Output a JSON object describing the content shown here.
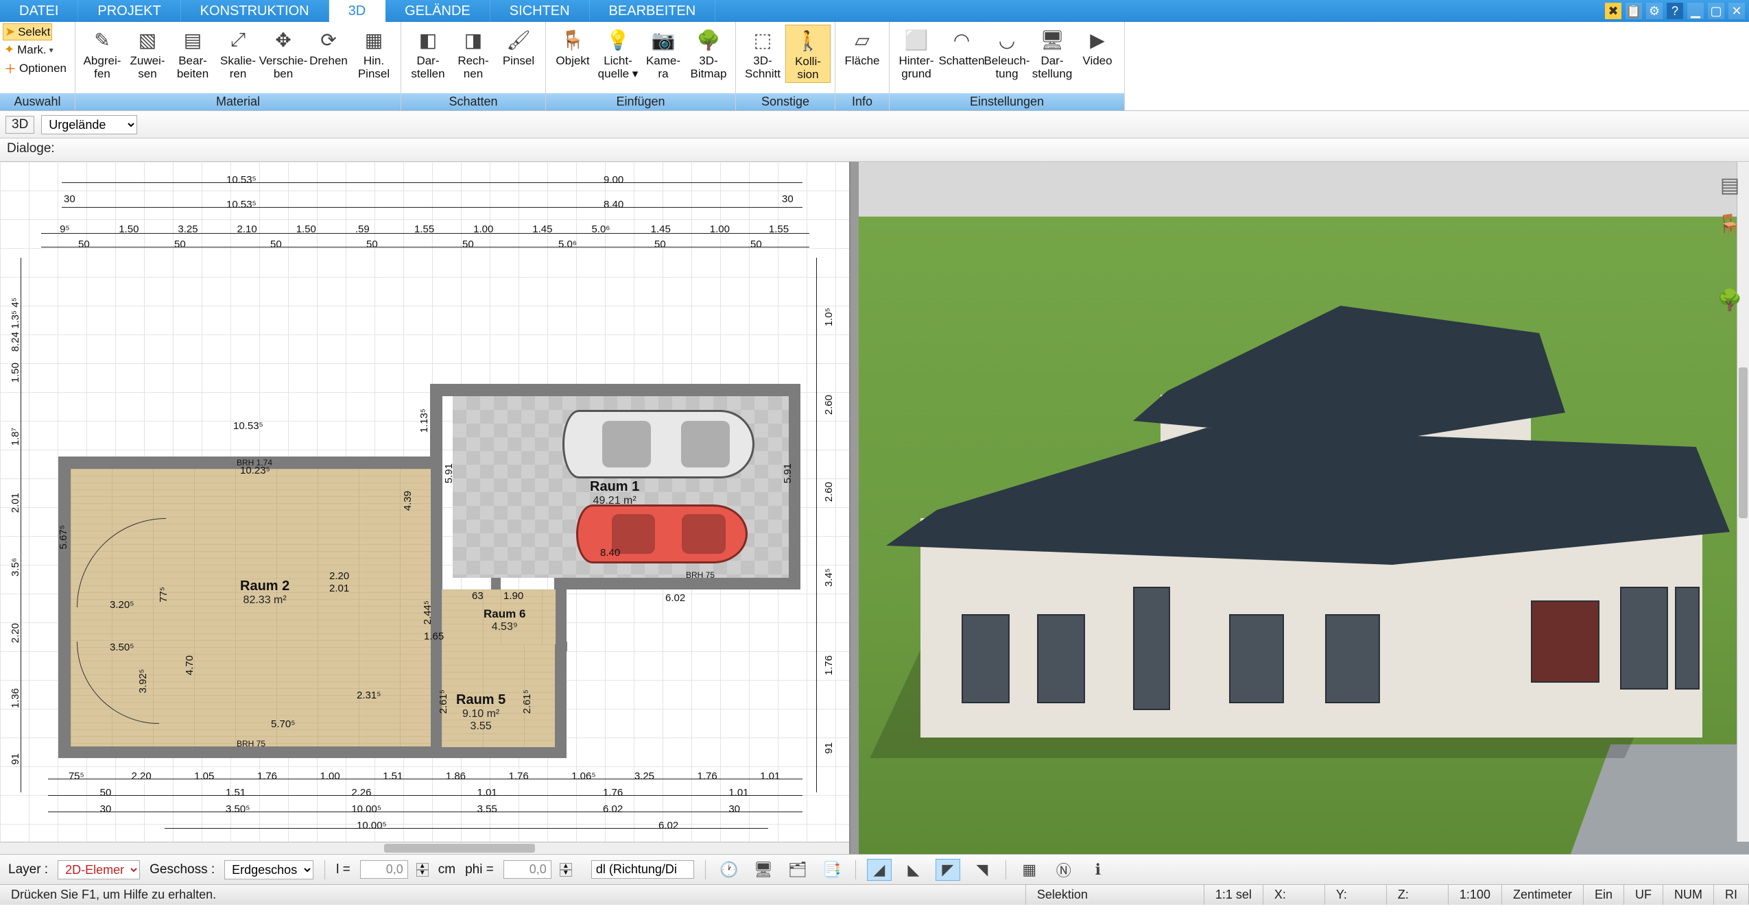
{
  "menu": {
    "tabs": [
      "DATEI",
      "PROJEKT",
      "KONSTRUKTION",
      "3D",
      "GELÄNDE",
      "SICHTEN",
      "BEARBEITEN"
    ],
    "active": 3
  },
  "auswahl": {
    "selekt": "Selekt",
    "mark": "Mark.",
    "optionen": "Optionen",
    "group": "Auswahl"
  },
  "ribbon_groups": [
    {
      "label": "Material",
      "buttons": [
        {
          "id": "abgreifen",
          "l1": "Abgrei-",
          "l2": "fen",
          "icon": "✎"
        },
        {
          "id": "zuweisen",
          "l1": "Zuwei-",
          "l2": "sen",
          "icon": "▧"
        },
        {
          "id": "bearbeiten",
          "l1": "Bear-",
          "l2": "beiten",
          "icon": "▤"
        },
        {
          "id": "skalieren",
          "l1": "Skalie-",
          "l2": "ren",
          "icon": "⤢"
        },
        {
          "id": "verschieben",
          "l1": "Verschie-",
          "l2": "ben",
          "icon": "✥"
        },
        {
          "id": "drehen",
          "l1": "Drehen",
          "l2": "",
          "icon": "⟳"
        },
        {
          "id": "hinpinsel",
          "l1": "Hin.",
          "l2": "Pinsel",
          "icon": "▦"
        }
      ]
    },
    {
      "label": "Schatten",
      "buttons": [
        {
          "id": "darstellen",
          "l1": "Dar-",
          "l2": "stellen",
          "icon": "◧"
        },
        {
          "id": "rechnen",
          "l1": "Rech-",
          "l2": "nen",
          "icon": "◨"
        },
        {
          "id": "pinsel",
          "l1": "Pinsel",
          "l2": "",
          "icon": "🖌"
        }
      ]
    },
    {
      "label": "Einfügen",
      "buttons": [
        {
          "id": "objekt",
          "l1": "Objekt",
          "l2": "",
          "icon": "🪑"
        },
        {
          "id": "lichtquelle",
          "l1": "Licht-",
          "l2": "quelle ▾",
          "icon": "💡"
        },
        {
          "id": "kamera",
          "l1": "Kame-",
          "l2": "ra",
          "icon": "📷"
        },
        {
          "id": "bitmap3d",
          "l1": "3D-",
          "l2": "Bitmap",
          "icon": "🌳"
        }
      ]
    },
    {
      "label": "Sonstige",
      "buttons": [
        {
          "id": "schnitt3d",
          "l1": "3D-",
          "l2": "Schnitt",
          "icon": "⬚"
        },
        {
          "id": "kollision",
          "l1": "Kolli-",
          "l2": "sion",
          "icon": "🚶",
          "active": true
        }
      ]
    },
    {
      "label": "Info",
      "buttons": [
        {
          "id": "flaeche",
          "l1": "Fläche",
          "l2": "",
          "icon": "▱"
        }
      ]
    },
    {
      "label": "Einstellungen",
      "buttons": [
        {
          "id": "hintergrund",
          "l1": "Hinter-",
          "l2": "grund",
          "icon": "⬜"
        },
        {
          "id": "schatten2",
          "l1": "Schatten",
          "l2": "",
          "icon": "◠"
        },
        {
          "id": "beleuchtung",
          "l1": "Beleuch-",
          "l2": "tung",
          "icon": "◡"
        },
        {
          "id": "darstellung",
          "l1": "Dar-",
          "l2": "stellung",
          "icon": "🖥"
        },
        {
          "id": "video",
          "l1": "Video",
          "l2": "",
          "icon": "▶"
        }
      ]
    }
  ],
  "secbar": {
    "badge": "3D",
    "dropdown": "Urgelände"
  },
  "dialogbar": {
    "label": "Dialoge:"
  },
  "plan": {
    "dims_top1": {
      "a": "10.53⁵",
      "b": "9.00"
    },
    "dims_top2": {
      "a": "10.53⁵",
      "b": "8.40"
    },
    "dims_top3": [
      "9⁵",
      "1.50",
      "3.25",
      "2.10",
      "1.50",
      ".59",
      "1.55",
      "1.00",
      "1.45",
      "5.0⁶",
      "1.45",
      "1.00",
      "1.55"
    ],
    "dims_top4": [
      "50",
      "50",
      "50",
      "50",
      "50",
      "5.0⁶",
      "50",
      "50"
    ],
    "dims_side_left": [
      "91",
      "1.36",
      "2.20",
      "3.5⁶",
      "2.01",
      "1.8⁷",
      "1.50",
      "8.24 1.3⁵ 4⁵"
    ],
    "dims_side_right": [
      "91",
      "1.76",
      "3.4⁵",
      "2.60",
      "2.60",
      "1.0⁵"
    ],
    "dims_bot1": [
      "75⁵",
      "2.20",
      "1.05",
      "1.76",
      "1.00",
      "1.51",
      "1.86",
      "1.76",
      "1.06⁵",
      "3.25",
      "1.76",
      "1.01"
    ],
    "dims_bot2": [
      "50",
      "1.51",
      "2.26",
      "1.01",
      "1.76",
      "1.01"
    ],
    "dims_bot3": [
      "30",
      "3.50⁵",
      "10.00⁵",
      "3.55",
      "6.02",
      "30"
    ],
    "dims_bot4": [
      "10.00⁵",
      "6.02"
    ],
    "dim_overall_bot": "10.00⁵",
    "i_left_a": "10.53⁵",
    "i_left_b": "10.23⁵",
    "i_6_02": "6.02",
    "i_190": "1.90",
    "i_570": "5.70⁵",
    "i_470": "4.70",
    "i_392": "3.92⁵",
    "i_320": "3.20⁵",
    "i_350": "3.50⁵",
    "i_439": "4.39",
    "i_591a": "5.91",
    "i_591b": "5.91",
    "i_840": "8.40",
    "i_455": "4.53⁹",
    "i_190b": "1.90",
    "i_244": "2.44⁵",
    "i_165": "1.65",
    "i_63": "63",
    "i_261a": "2.61⁵",
    "i_261b": "2.61⁵",
    "i_220": "2.20",
    "i_201": "2.01",
    "i_567": "5.67⁵",
    "i_77": "77⁵",
    "i_113": "1.13⁵",
    "i_231": "2.31⁵",
    "brh": "BRH 1.74",
    "brh75": "BRH 75",
    "room1": {
      "name": "Raum 1",
      "area": "49.21 m²"
    },
    "room2": {
      "name": "Raum 2",
      "area": "82.33 m²"
    },
    "room5": {
      "name": "Raum 5",
      "area": "9.10 m²",
      "w": "3.55"
    },
    "room6": {
      "name": "Raum 6",
      "area": "4.53⁹"
    },
    "marker30": "30"
  },
  "toolbar2": {
    "layer_lbl": "Layer :",
    "layer_val": "2D-Elemen",
    "geschoss_lbl": "Geschoss :",
    "geschoss_val": "Erdgeschos",
    "l_lbl": "l =",
    "l_val": "0,0",
    "l_unit": "cm",
    "phi_lbl": "phi =",
    "phi_val": "0,0",
    "phi_unit": "",
    "dl": "dl (Richtung/Di"
  },
  "status": {
    "hint": "Drücken Sie F1, um Hilfe zu erhalten.",
    "sel": "Selektion",
    "ratio": "1:1 sel",
    "x": "X:",
    "y": "Y:",
    "z": "Z:",
    "scale": "1:100",
    "unit": "Zentimeter",
    "ein": "Ein",
    "uf": "UF",
    "num": "NUM",
    "ri": "RI"
  }
}
